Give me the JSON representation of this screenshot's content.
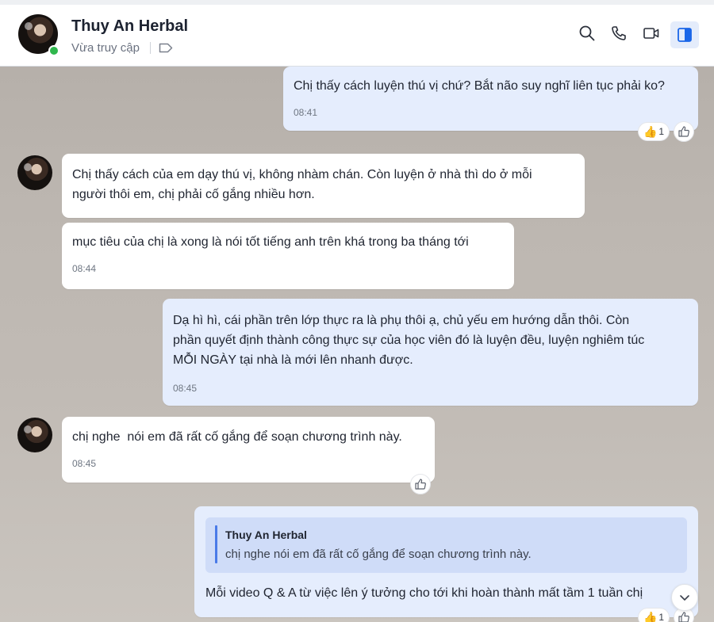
{
  "header": {
    "contact_name": "Thuy An Herbal",
    "status": "Vừa truy cập",
    "icons": [
      "search-icon",
      "phone-icon",
      "video-call-icon",
      "panel-toggle-icon"
    ]
  },
  "messages": [
    {
      "id": "m1",
      "direction": "out",
      "text": "Chị thấy cách luyện thú vị chứ? Bắt não suy nghĩ liên tục phải ko?",
      "time": "08:41",
      "reaction_count": "1"
    },
    {
      "id": "m2",
      "direction": "in",
      "text_lines": [
        "Chị thấy cách của em dạy thú vị, không nhàm chán. Còn luyện ở nhà thì do ở mỗi",
        "người thôi em, chị phải cố gắng nhiều hơn."
      ]
    },
    {
      "id": "m3",
      "direction": "in",
      "text": "mục tiêu của chị là xong là nói tốt tiếng anh trên khá trong ba tháng tới",
      "time": "08:44"
    },
    {
      "id": "m4",
      "direction": "out",
      "text_lines": [
        "Dạ hì hì, cái phần trên lớp thực ra là phụ thôi ạ, chủ yếu em hướng dẫn thôi. Còn",
        "phần quyết định thành công thực sự của học viên đó là luyện đều, luyện nghiêm túc",
        "MỖI NGÀY tại nhà là mới lên nhanh được."
      ],
      "time": "08:45"
    },
    {
      "id": "m5",
      "direction": "in",
      "text": "chị nghe  nói em đã rất cố gắng để soạn chương trình này.",
      "time": "08:45"
    },
    {
      "id": "m6",
      "direction": "out",
      "quote": {
        "author": "Thuy An Herbal",
        "text": "chị nghe nói em đã rất cố gắng để soạn chương trình này."
      },
      "text": "Mỗi video Q & A từ việc lên ý tưởng cho tới khi hoàn thành mất tầm 1 tuần chị",
      "reaction_count": "1"
    }
  ],
  "colors": {
    "accent": "#4a7ae8",
    "outgoing_bubble": "#e5edfd",
    "incoming_bubble": "#ffffff",
    "online": "#2fb74d"
  }
}
